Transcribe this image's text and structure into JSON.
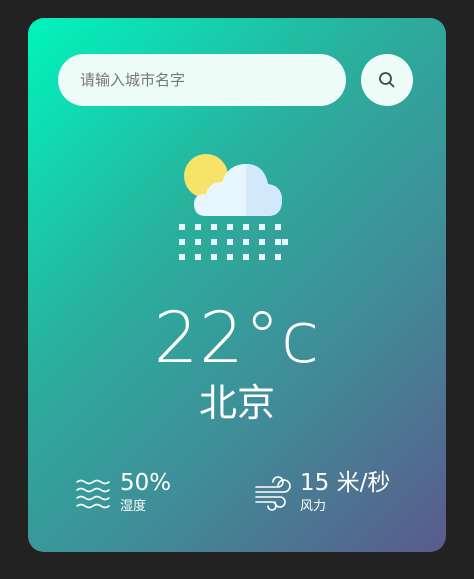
{
  "search": {
    "placeholder": "请输入城市名字",
    "value": ""
  },
  "weather": {
    "temperature": "22°c",
    "city": "北京",
    "condition_icon": "sun-cloud-snow-icon"
  },
  "stats": {
    "humidity": {
      "value": "50%",
      "label": "湿度",
      "icon": "humidity-waves-icon"
    },
    "wind": {
      "value": "15 米/秒",
      "label": "风力",
      "icon": "wind-icon"
    }
  },
  "colors": {
    "gradient_start": "#00f5bd",
    "gradient_end": "#5a5b8c",
    "input_bg": "#eefcf8",
    "page_bg": "#222222"
  }
}
